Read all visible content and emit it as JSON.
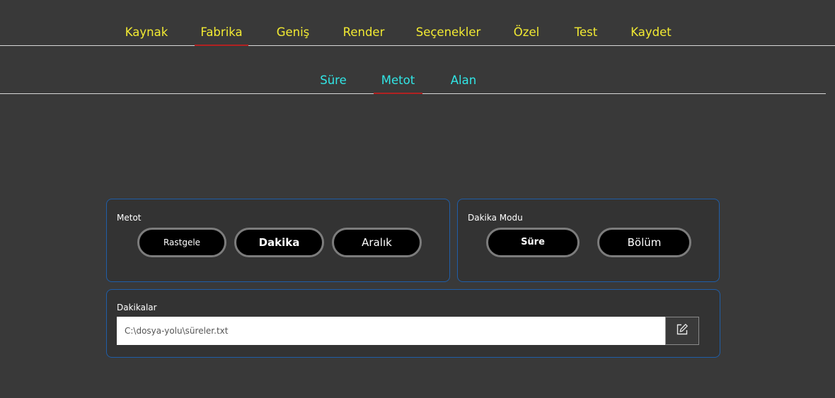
{
  "main_tabs": [
    {
      "label": "Kaynak"
    },
    {
      "label": "Fabrika"
    },
    {
      "label": "Geniş"
    },
    {
      "label": "Render"
    },
    {
      "label": "Seçenekler"
    },
    {
      "label": "Özel"
    },
    {
      "label": "Test"
    },
    {
      "label": "Kaydet"
    }
  ],
  "main_active_tab": "Fabrika",
  "sub_tabs": [
    {
      "label": "Süre"
    },
    {
      "label": "Metot"
    },
    {
      "label": "Alan"
    }
  ],
  "sub_active_tab": "Metot",
  "method_panel": {
    "title": "Metot",
    "options": [
      "Rastgele",
      "Dakika",
      "Aralık"
    ],
    "selected": "Dakika"
  },
  "mode_panel": {
    "title": "Dakika Modu",
    "options": [
      "Süre",
      "Bölüm"
    ],
    "selected": "Süre"
  },
  "minutes_panel": {
    "title": "Dakikalar",
    "file_path": "C:\\dosya-yolu\\süreler.txt",
    "edit_icon": "edit-icon"
  },
  "colors": {
    "background": "#393939",
    "main_tab_text": "#f2ea32",
    "sub_tab_text": "#31e6e6",
    "active_underline": "#b22222",
    "panel_border": "#1f5ea8"
  }
}
